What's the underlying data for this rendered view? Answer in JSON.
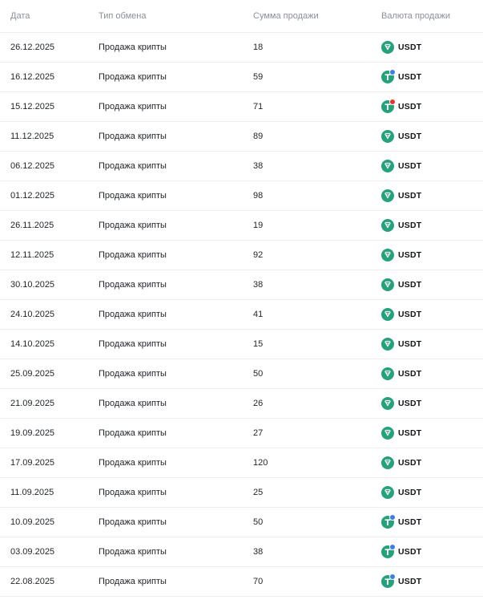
{
  "table": {
    "headers": {
      "date": "Дата",
      "exchange_type": "Тип обмена",
      "sale_amount": "Сумма продажи",
      "sale_currency": "Валюта продажи"
    },
    "rows": [
      {
        "date": "26.12.2025",
        "type": "Продажа крипты",
        "amount": "18",
        "currency": "USDT",
        "icon": "tether-shield-icon"
      },
      {
        "date": "16.12.2025",
        "type": "Продажа крипты",
        "amount": "59",
        "currency": "USDT",
        "icon": "tether-t-icon",
        "badge": "ton"
      },
      {
        "date": "15.12.2025",
        "type": "Продажа крипты",
        "amount": "71",
        "currency": "USDT",
        "icon": "tether-t-icon",
        "badge": "tron"
      },
      {
        "date": "11.12.2025",
        "type": "Продажа крипты",
        "amount": "89",
        "currency": "USDT",
        "icon": "tether-shield-icon"
      },
      {
        "date": "06.12.2025",
        "type": "Продажа крипты",
        "amount": "38",
        "currency": "USDT",
        "icon": "tether-shield-icon"
      },
      {
        "date": "01.12.2025",
        "type": "Продажа крипты",
        "amount": "98",
        "currency": "USDT",
        "icon": "tether-shield-icon"
      },
      {
        "date": "26.11.2025",
        "type": "Продажа крипты",
        "amount": "19",
        "currency": "USDT",
        "icon": "tether-shield-icon"
      },
      {
        "date": "12.11.2025",
        "type": "Продажа крипты",
        "amount": "92",
        "currency": "USDT",
        "icon": "tether-shield-icon"
      },
      {
        "date": "30.10.2025",
        "type": "Продажа крипты",
        "amount": "38",
        "currency": "USDT",
        "icon": "tether-shield-icon"
      },
      {
        "date": "24.10.2025",
        "type": "Продажа крипты",
        "amount": "41",
        "currency": "USDT",
        "icon": "tether-shield-icon"
      },
      {
        "date": "14.10.2025",
        "type": "Продажа крипты",
        "amount": "15",
        "currency": "USDT",
        "icon": "tether-shield-icon"
      },
      {
        "date": "25.09.2025",
        "type": "Продажа крипты",
        "amount": "50",
        "currency": "USDT",
        "icon": "tether-shield-icon"
      },
      {
        "date": "21.09.2025",
        "type": "Продажа крипты",
        "amount": "26",
        "currency": "USDT",
        "icon": "tether-shield-icon"
      },
      {
        "date": "19.09.2025",
        "type": "Продажа крипты",
        "amount": "27",
        "currency": "USDT",
        "icon": "tether-shield-icon"
      },
      {
        "date": "17.09.2025",
        "type": "Продажа крипты",
        "amount": "120",
        "currency": "USDT",
        "icon": "tether-shield-icon"
      },
      {
        "date": "11.09.2025",
        "type": "Продажа крипты",
        "amount": "25",
        "currency": "USDT",
        "icon": "tether-shield-icon"
      },
      {
        "date": "10.09.2025",
        "type": "Продажа крипты",
        "amount": "50",
        "currency": "USDT",
        "icon": "tether-t-icon",
        "badge": "ton"
      },
      {
        "date": "03.09.2025",
        "type": "Продажа крипты",
        "amount": "38",
        "currency": "USDT",
        "icon": "tether-t-icon",
        "badge": "ton"
      },
      {
        "date": "22.08.2025",
        "type": "Продажа крипты",
        "amount": "70",
        "currency": "USDT",
        "icon": "tether-t-icon",
        "badge": "ton"
      }
    ]
  },
  "colors": {
    "tether_green": "#26a17b",
    "ton_badge": "#3d7de0",
    "tron_badge": "#e5322d"
  }
}
